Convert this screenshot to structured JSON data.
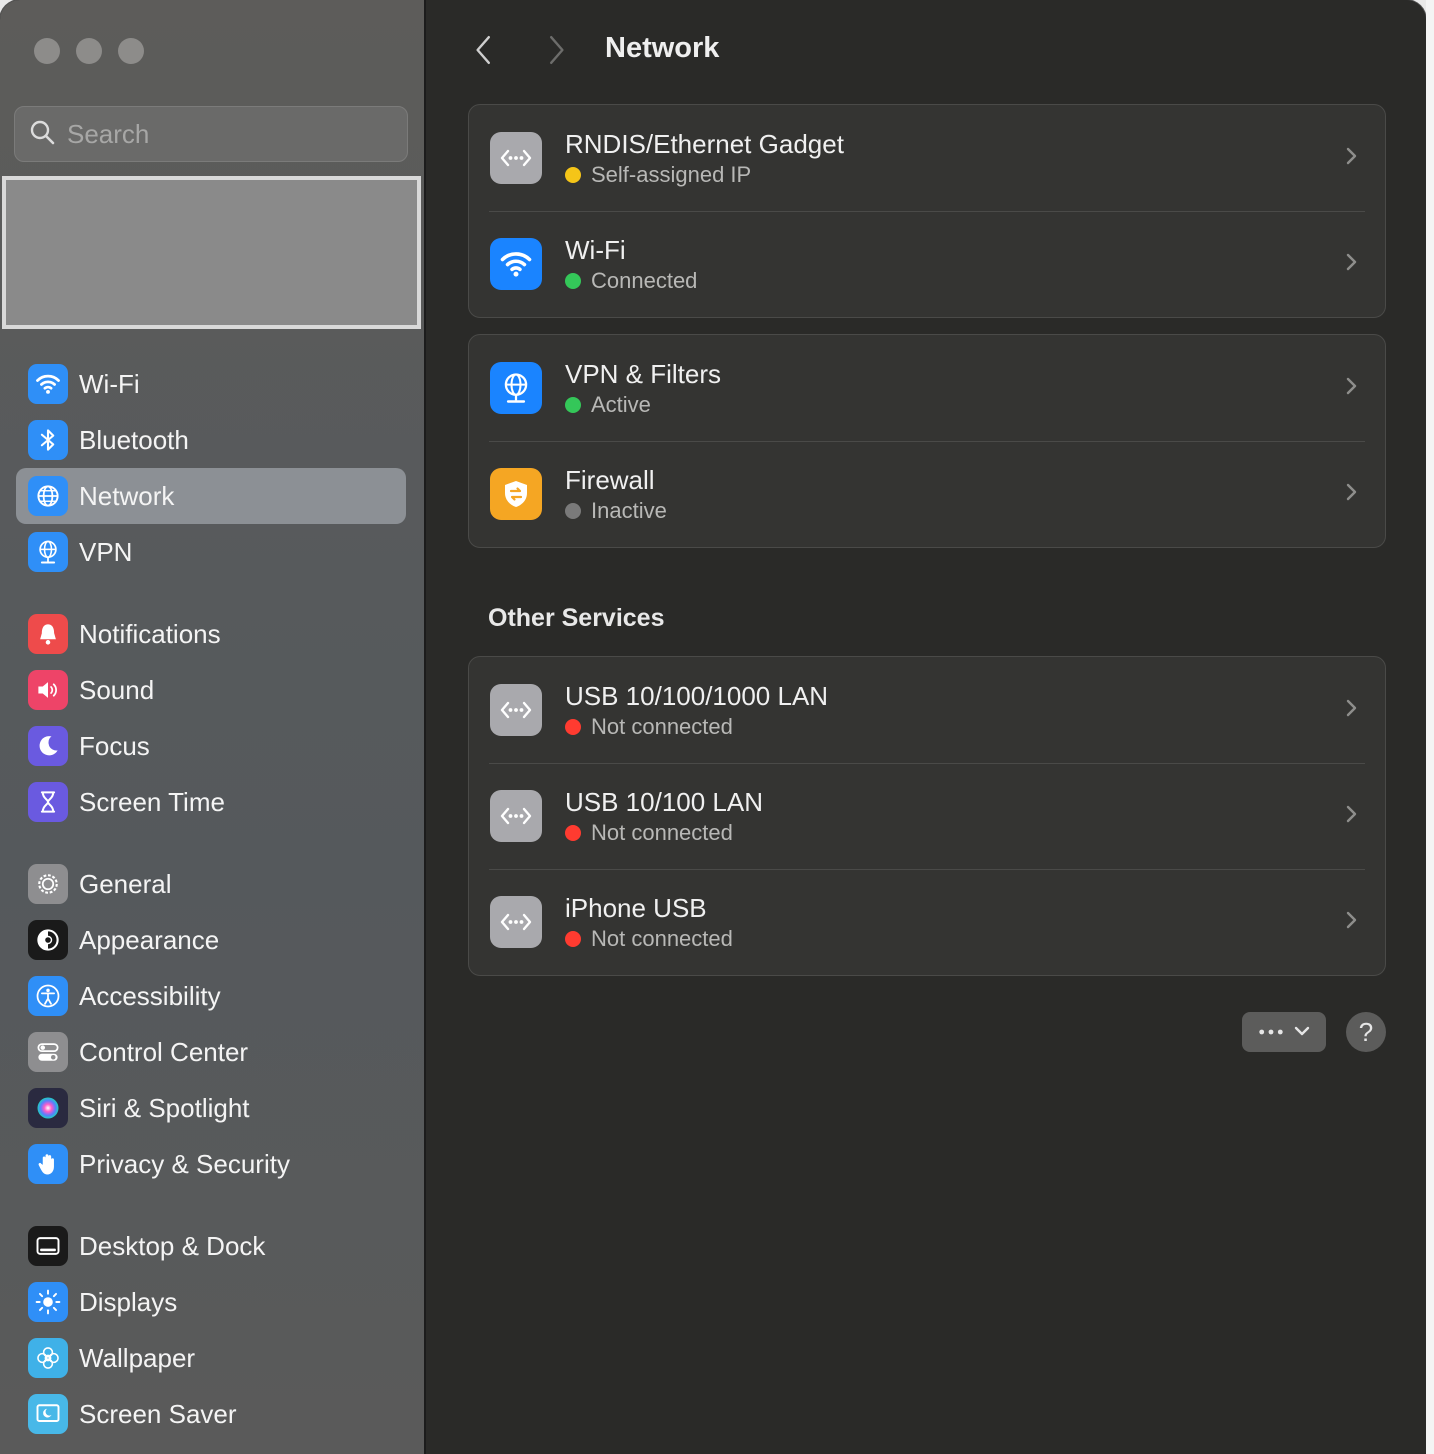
{
  "window": {
    "traffic_lights": [
      "close",
      "minimize",
      "zoom"
    ]
  },
  "sidebar": {
    "search_placeholder": "Search",
    "sections": [
      [
        {
          "label": "Wi-Fi",
          "icon": "wifi-icon",
          "color": "#2f8ff7",
          "active": false
        },
        {
          "label": "Bluetooth",
          "icon": "bluetooth-icon",
          "color": "#2f8ff7",
          "active": false
        },
        {
          "label": "Network",
          "icon": "globe-icon",
          "color": "#2f8ff7",
          "active": true
        },
        {
          "label": "VPN",
          "icon": "vpn-globe-icon",
          "color": "#2f8ff7",
          "active": false
        }
      ],
      [
        {
          "label": "Notifications",
          "icon": "bell-icon",
          "color": "#ee4b4b",
          "active": false
        },
        {
          "label": "Sound",
          "icon": "speaker-icon",
          "color": "#ee4468",
          "active": false
        },
        {
          "label": "Focus",
          "icon": "moon-icon",
          "color": "#6a5ae0",
          "active": false
        },
        {
          "label": "Screen Time",
          "icon": "hourglass-icon",
          "color": "#6a5ae0",
          "active": false
        }
      ],
      [
        {
          "label": "General",
          "icon": "gear-icon",
          "color": "#8e8e90",
          "active": false
        },
        {
          "label": "Appearance",
          "icon": "appearance-icon",
          "color": "#1a1a1a",
          "active": false
        },
        {
          "label": "Accessibility",
          "icon": "accessibility-icon",
          "color": "#2f8ff7",
          "active": false
        },
        {
          "label": "Control Center",
          "icon": "toggles-icon",
          "color": "#8e8e90",
          "active": false
        },
        {
          "label": "Siri & Spotlight",
          "icon": "siri-icon",
          "color": "#2a2a40",
          "active": false
        },
        {
          "label": "Privacy & Security",
          "icon": "hand-icon",
          "color": "#2f8ff7",
          "active": false
        }
      ],
      [
        {
          "label": "Desktop & Dock",
          "icon": "dock-icon",
          "color": "#1a1a1a",
          "active": false
        },
        {
          "label": "Displays",
          "icon": "sun-icon",
          "color": "#2f8ff7",
          "active": false
        },
        {
          "label": "Wallpaper",
          "icon": "flower-icon",
          "color": "#3fb1e8",
          "active": false
        },
        {
          "label": "Screen Saver",
          "icon": "screensaver-icon",
          "color": "#48b8e8",
          "active": false
        }
      ]
    ]
  },
  "main": {
    "title": "Network",
    "groups": [
      [
        {
          "name": "RNDIS/Ethernet Gadget",
          "status": "Self-assigned IP",
          "status_color": "#f5c518",
          "icon": "ethernet-icon",
          "icon_bg": "#a9a9ad"
        },
        {
          "name": "Wi-Fi",
          "status": "Connected",
          "status_color": "#34c759",
          "icon": "wifi-icon",
          "icon_bg": "#1a84ff"
        }
      ],
      [
        {
          "name": "VPN & Filters",
          "status": "Active",
          "status_color": "#34c759",
          "icon": "vpn-globe-icon",
          "icon_bg": "#1a84ff"
        },
        {
          "name": "Firewall",
          "status": "Inactive",
          "status_color": "#7a7a7a",
          "icon": "firewall-icon",
          "icon_bg": "#f5a623"
        }
      ]
    ],
    "other_services_title": "Other Services",
    "other_services": [
      {
        "name": "USB 10/100/1000 LAN",
        "status": "Not connected",
        "status_color": "#ff3b30",
        "icon": "ethernet-icon",
        "icon_bg": "#a9a9ad"
      },
      {
        "name": "USB 10/100 LAN",
        "status": "Not connected",
        "status_color": "#ff3b30",
        "icon": "ethernet-icon",
        "icon_bg": "#a9a9ad"
      },
      {
        "name": "iPhone USB",
        "status": "Not connected",
        "status_color": "#ff3b30",
        "icon": "ethernet-icon",
        "icon_bg": "#a9a9ad"
      }
    ],
    "help_label": "?"
  }
}
